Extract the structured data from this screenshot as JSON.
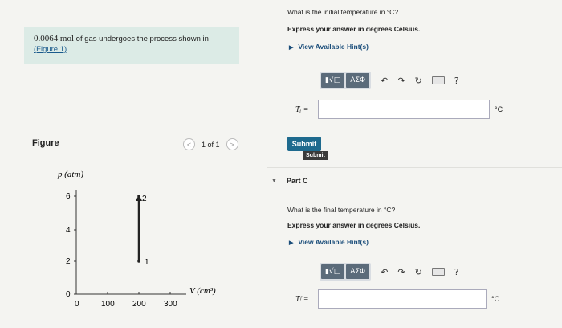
{
  "problem": {
    "amount": "0.0064",
    "unit": "mol",
    "text": " of gas undergoes the process shown in",
    "figure_link": "(Figure 1)",
    "suffix": "."
  },
  "figure": {
    "label": "Figure",
    "pager": {
      "prev": "<",
      "page": "1 of 1",
      "next": ">"
    }
  },
  "graph": {
    "ylabel": "p (atm)",
    "xlabel": "V (cm³)",
    "yticks": [
      "0",
      "2",
      "4",
      "6"
    ],
    "xticks": [
      "0",
      "100",
      "200",
      "300"
    ],
    "point_1": "1",
    "point_2": "2"
  },
  "chart_data": {
    "type": "line",
    "xlabel": "V (cm³)",
    "ylabel": "p (atm)",
    "xlim": [
      0,
      300
    ],
    "ylim": [
      0,
      6
    ],
    "series": [
      {
        "points": [
          {
            "x": 200,
            "y": 1,
            "label": "1"
          },
          {
            "x": 200,
            "y": 6,
            "label": "2"
          }
        ]
      }
    ]
  },
  "part_b": {
    "question": "What is the initial temperature in °C?",
    "instruction": "Express your answer in degrees Celsius.",
    "hints": "View Available Hint(s)",
    "var_label": "Tᵢ =",
    "unit": "°C",
    "input_value": "",
    "submit": "Submit",
    "tooltip": "Submit"
  },
  "part_c": {
    "title": "Part C",
    "question": "What is the final temperature in °C?",
    "instruction": "Express your answer in degrees Celsius.",
    "hints": "View Available Hint(s)",
    "var_label": "Tᶠ =",
    "unit": "°C",
    "input_value": ""
  },
  "toolbar": {
    "template_btn": "▮√□",
    "greek_btn": "ΑΣΦ",
    "undo": "↶",
    "redo": "↷",
    "reset": "↻",
    "help": "?"
  }
}
